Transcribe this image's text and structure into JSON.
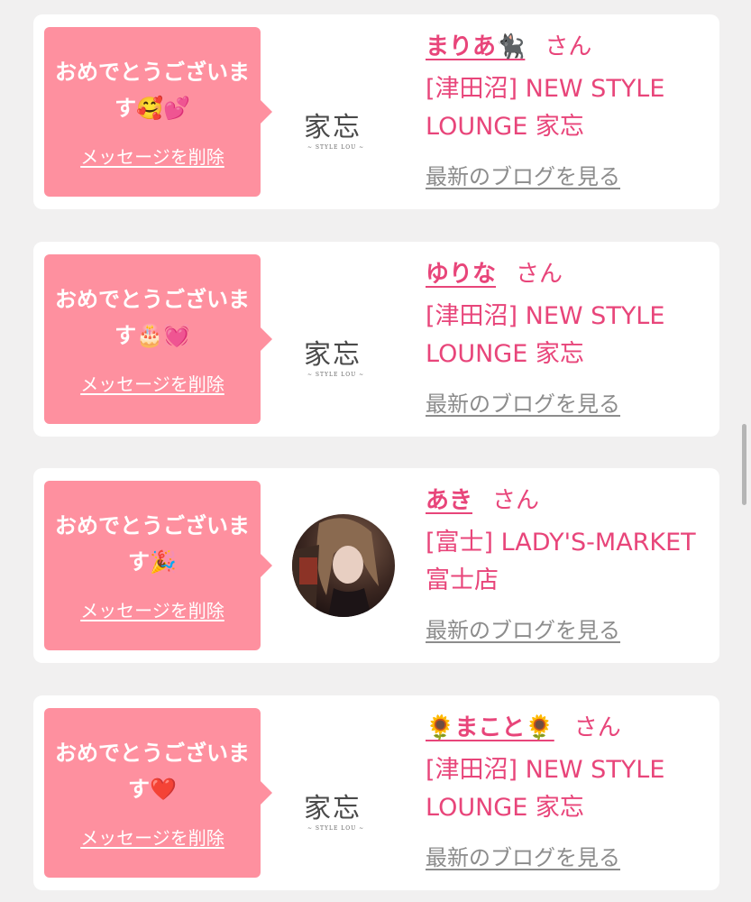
{
  "cards": [
    {
      "message": "おめでとうございます🥰💕",
      "delete_label": "メッセージを削除",
      "thumbnail": "logo",
      "logo_text": "家忘",
      "logo_sub": "~ STYLE LOU ~",
      "name": "まりあ🐈‍⬛",
      "honorific": "さん",
      "shop": "[津田沼] NEW STYLE LOUNGE 家忘",
      "blog_label": "最新のブログを見る"
    },
    {
      "message": "おめでとうございます🎂💓",
      "delete_label": "メッセージを削除",
      "thumbnail": "logo",
      "logo_text": "家忘",
      "logo_sub": "~ STYLE LOU ~",
      "name": "ゆりな",
      "honorific": "さん",
      "shop": "[津田沼] NEW STYLE LOUNGE 家忘",
      "blog_label": "最新のブログを見る"
    },
    {
      "message": "おめでとうございます🎉",
      "delete_label": "メッセージを削除",
      "thumbnail": "photo",
      "name": "あき",
      "honorific": "さん",
      "shop": "[富士] LADY'S-MARKET 富士店",
      "blog_label": "最新のブログを見る"
    },
    {
      "message": "おめでとうございます❤️",
      "delete_label": "メッセージを削除",
      "thumbnail": "logo",
      "logo_text": "家忘",
      "logo_sub": "~ STYLE LOU ~",
      "name": "🌻まこと🌻",
      "honorific": "さん",
      "shop": "[津田沼] NEW STYLE LOUNGE 家忘",
      "blog_label": "最新のブログを見る"
    }
  ],
  "colors": {
    "bubble": "#fe909f",
    "accent": "#e8457a",
    "link_gray": "#8c8c8c",
    "background": "#f1f0f0"
  }
}
